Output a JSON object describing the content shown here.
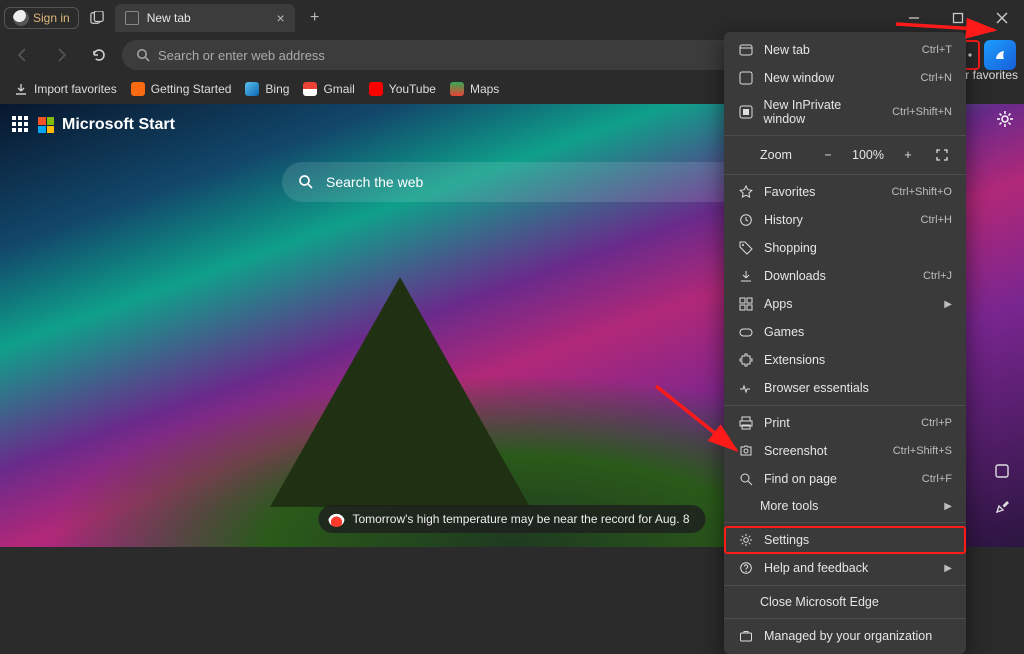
{
  "titlebar": {
    "signin": "Sign in",
    "tab_title": "New tab",
    "tab_close": "×",
    "newtab_plus": "+"
  },
  "toolbar": {
    "address_placeholder": "Search or enter web address"
  },
  "favorites": {
    "import": "Import favorites",
    "items": [
      {
        "label": "Getting Started",
        "color": "#f86b12"
      },
      {
        "label": "Bing",
        "color": "#5cc2ef"
      },
      {
        "label": "Gmail",
        "color": "#ea4335"
      },
      {
        "label": "YouTube",
        "color": "#ff0000"
      },
      {
        "label": "Maps",
        "color": "#34a853"
      }
    ],
    "other": "ther favorites"
  },
  "start": {
    "brand": "Microsoft Start",
    "search_placeholder": "Search the web",
    "weather_text": "Tomorrow's high temperature may be near the record for Aug. 8"
  },
  "menu": {
    "new_tab": "New tab",
    "new_tab_sc": "Ctrl+T",
    "new_window": "New window",
    "new_window_sc": "Ctrl+N",
    "new_inprivate": "New InPrivate window",
    "new_inprivate_sc": "Ctrl+Shift+N",
    "zoom_label": "Zoom",
    "zoom_value": "100%",
    "favorites": "Favorites",
    "favorites_sc": "Ctrl+Shift+O",
    "history": "History",
    "history_sc": "Ctrl+H",
    "shopping": "Shopping",
    "downloads": "Downloads",
    "downloads_sc": "Ctrl+J",
    "apps": "Apps",
    "games": "Games",
    "extensions": "Extensions",
    "essentials": "Browser essentials",
    "print": "Print",
    "print_sc": "Ctrl+P",
    "screenshot": "Screenshot",
    "screenshot_sc": "Ctrl+Shift+S",
    "find": "Find on page",
    "find_sc": "Ctrl+F",
    "more_tools": "More tools",
    "settings": "Settings",
    "help": "Help and feedback",
    "close_edge": "Close Microsoft Edge",
    "managed": "Managed by your organization"
  }
}
